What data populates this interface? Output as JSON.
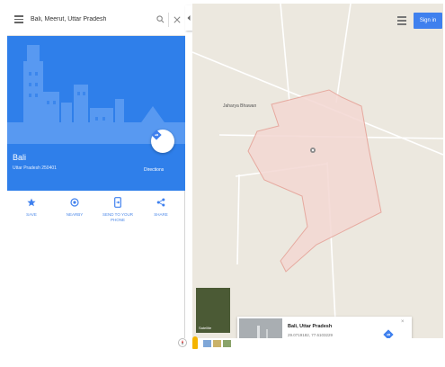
{
  "search": {
    "query": "Bali, Meerut, Uttar Pradesh"
  },
  "place": {
    "name": "Bali",
    "address": "Uttar Pradesh 250401",
    "directions_label": "Directions"
  },
  "actions": [
    {
      "label": "SAVE",
      "icon": "star-icon"
    },
    {
      "label": "NEARBY",
      "icon": "nearby-icon"
    },
    {
      "label": "SEND TO YOUR PHONE",
      "icon": "phone-icon"
    },
    {
      "label": "SHARE",
      "icon": "share-icon"
    }
  ],
  "map": {
    "poi_label": "Jaharya Bhawan",
    "signin_label": "Sign in",
    "satellite_label": "Satellite"
  },
  "card": {
    "title": "Bali, Uttar Pradesh",
    "coords": "29.0719182, 77.6103229"
  },
  "colors": {
    "brand_blue": "#3f80ee",
    "boundary_fill": "#f3d7d2",
    "boundary_stroke": "#e6a99f",
    "map_bg": "#ece8df"
  }
}
